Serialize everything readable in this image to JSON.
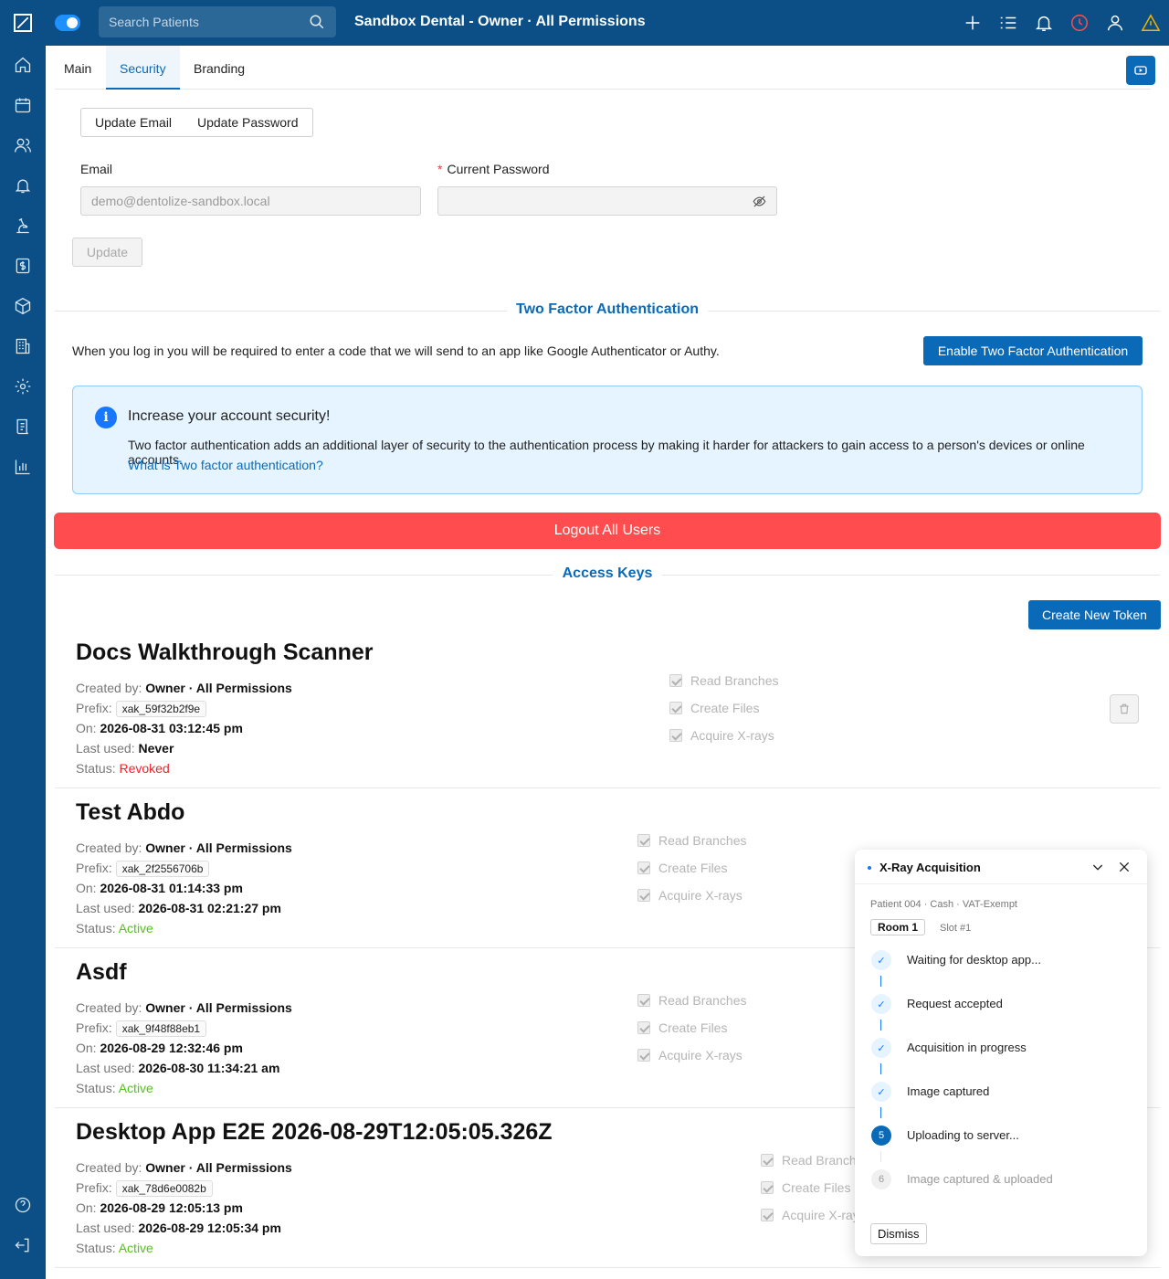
{
  "topbar": {
    "search_placeholder": "Search Patients",
    "title": "Sandbox Dental - Owner · All Permissions"
  },
  "tabs": [
    "Main",
    "Security",
    "Branding"
  ],
  "security": {
    "update_email": "Update Email",
    "update_password": "Update Password",
    "email_label": "Email",
    "email_value": "demo@dentolize-sandbox.local",
    "required_mark": "*",
    "password_label": "Current Password",
    "update_button": "Update"
  },
  "two_factor": {
    "heading": "Two Factor Authentication",
    "description": "When you log in you will be required to enter a code that we will send to an app like Google Authenticator or Authy.",
    "enable_button": "Enable Two Factor Authentication",
    "alert_icon": "i",
    "alert_title": "Increase your account security!",
    "alert_text": "Two factor authentication adds an additional layer of security to the authentication process by making it harder for attackers to gain access to a person's devices or online accounts.",
    "alert_link": "What is Two factor authentication?"
  },
  "logout_button": "Logout All Users",
  "access_keys": {
    "heading": "Access Keys",
    "create_button": "Create New Token",
    "labels": {
      "created_by": "Created by:",
      "prefix": "Prefix:",
      "on": "On:",
      "last_used": "Last used:",
      "status": "Status:"
    },
    "tokens": [
      {
        "name": "Docs Walkthrough Scanner",
        "created_by": "Owner · All Permissions",
        "prefix": "xak_59f32b2f9e",
        "on": "2026-08-31 03:12:45 pm",
        "last_used": "Never",
        "status": "Revoked",
        "permissions": [
          "Read Branches",
          "Create Files",
          "Acquire X-rays"
        ]
      },
      {
        "name": "Test Abdo",
        "created_by": "Owner · All Permissions",
        "prefix": "xak_2f2556706b",
        "on": "2026-08-31 01:14:33 pm",
        "last_used": "2026-08-31 02:21:27 pm",
        "status": "Active",
        "permissions": [
          "Read Branches",
          "Create Files",
          "Acquire X-rays"
        ]
      },
      {
        "name": "Asdf",
        "created_by": "Owner · All Permissions",
        "prefix": "xak_9f48f88eb1",
        "on": "2026-08-29 12:32:46 pm",
        "last_used": "2026-08-30 11:34:21 am",
        "status": "Active",
        "permissions": [
          "Read Branches",
          "Create Files",
          "Acquire X-rays"
        ]
      },
      {
        "name": "Desktop App E2E 2026-08-29T12:05:05.326Z",
        "created_by": "Owner · All Permissions",
        "prefix": "xak_78d6e0082b",
        "on": "2026-08-29 12:05:13 pm",
        "last_used": "2026-08-29 12:05:34 pm",
        "status": "Active",
        "permissions": [
          "Read Branches",
          "Create Files",
          "Acquire X-rays"
        ]
      }
    ]
  },
  "xray_panel": {
    "title": "X-Ray Acquisition",
    "meta": "Patient 004 · Cash · VAT-Exempt",
    "room": "Room 1",
    "slot": "Slot #1",
    "steps": [
      {
        "label": "Waiting for desktop app...",
        "state": "done",
        "marker": "✓"
      },
      {
        "label": "Request accepted",
        "state": "done",
        "marker": "✓"
      },
      {
        "label": "Acquisition in progress",
        "state": "done",
        "marker": "✓"
      },
      {
        "label": "Image captured",
        "state": "done",
        "marker": "✓"
      },
      {
        "label": "Uploading to server...",
        "state": "current",
        "marker": "5"
      },
      {
        "label": "Image captured & uploaded",
        "state": "waiting",
        "marker": "6"
      }
    ],
    "dismiss": "Dismiss"
  },
  "colors": {
    "sidebar": "#0b4f86",
    "primary": "#0b6ab8",
    "danger": "#ff4d4f",
    "active_status": "#52c41a",
    "revoked_status": "#f5222d",
    "warning_icon": "#f5b400",
    "history_icon": "#ff4d4f"
  }
}
